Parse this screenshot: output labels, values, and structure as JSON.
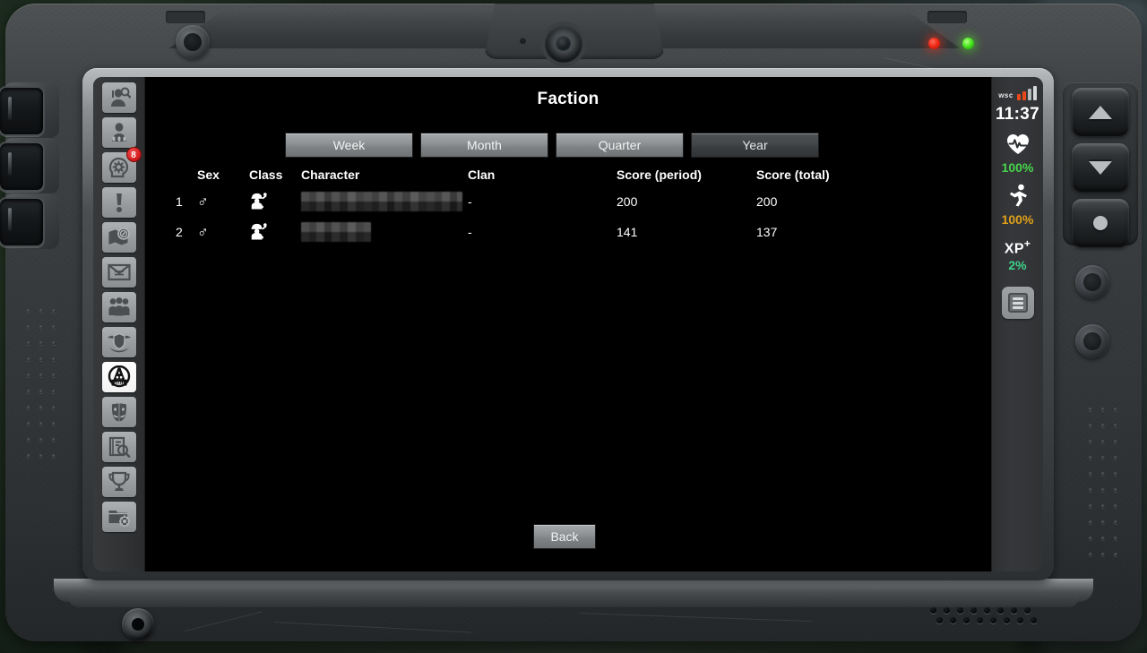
{
  "device": {
    "name": "rugged-tablet",
    "leds": [
      {
        "name": "led-red",
        "color": "#f02a16"
      },
      {
        "name": "led-green",
        "color": "#49e81f"
      }
    ],
    "hardware_buttons": [
      {
        "name": "up-button",
        "icon": "triangle-up-icon"
      },
      {
        "name": "down-button",
        "icon": "triangle-down-icon"
      },
      {
        "name": "select-button",
        "icon": "dot-icon"
      }
    ]
  },
  "sidebar": {
    "items": [
      {
        "name": "sidebar-item-character-search",
        "icon": "person-search-icon",
        "active": false,
        "badge": null
      },
      {
        "name": "sidebar-item-equipment",
        "icon": "person-equipment-icon",
        "active": false,
        "badge": null
      },
      {
        "name": "sidebar-item-skills",
        "icon": "head-gear-icon",
        "active": false,
        "badge": "8"
      },
      {
        "name": "sidebar-item-alerts",
        "icon": "exclamation-icon",
        "active": false,
        "badge": null
      },
      {
        "name": "sidebar-item-map",
        "icon": "map-compass-icon",
        "active": false,
        "badge": null
      },
      {
        "name": "sidebar-item-mail",
        "icon": "envelope-icon",
        "active": false,
        "badge": null
      },
      {
        "name": "sidebar-item-group",
        "icon": "group-people-icon",
        "active": false,
        "badge": null
      },
      {
        "name": "sidebar-item-clan",
        "icon": "winged-shield-icon",
        "active": false,
        "badge": null
      },
      {
        "name": "sidebar-item-faction",
        "icon": "anarchy-skull-icon",
        "active": true,
        "badge": null
      },
      {
        "name": "sidebar-item-reputation",
        "icon": "theatre-masks-icon",
        "active": false,
        "badge": null
      },
      {
        "name": "sidebar-item-journal",
        "icon": "book-search-icon",
        "active": false,
        "badge": null
      },
      {
        "name": "sidebar-item-achievements",
        "icon": "trophy-icon",
        "active": false,
        "badge": null
      },
      {
        "name": "sidebar-item-settings",
        "icon": "folder-gear-icon",
        "active": false,
        "badge": null
      }
    ]
  },
  "main": {
    "title": "Faction",
    "tabs": [
      {
        "label": "Week",
        "active": false
      },
      {
        "label": "Month",
        "active": false
      },
      {
        "label": "Quarter",
        "active": false
      },
      {
        "label": "Year",
        "active": true
      }
    ],
    "table": {
      "headers": {
        "rank": "",
        "sex": "Sex",
        "class": "Class",
        "character": "Character",
        "clan": "Clan",
        "score_period": "Score (period)",
        "score_total": "Score (total)"
      },
      "rows": [
        {
          "rank": "1",
          "sex_symbol": "♂",
          "class_icon": "engineer-icon",
          "character": "",
          "character_censored": true,
          "character_width": 180,
          "clan": "-",
          "score_period": "200",
          "score_total": "200"
        },
        {
          "rank": "2",
          "sex_symbol": "♂",
          "class_icon": "engineer-icon",
          "character": "",
          "character_censored": true,
          "character_width": 78,
          "clan": "-",
          "score_period": "141",
          "score_total": "137"
        }
      ]
    },
    "back_label": "Back"
  },
  "status": {
    "signal_label": "wsc",
    "signal_bars": [
      {
        "height": 7,
        "color": "#e8481c"
      },
      {
        "height": 10,
        "color": "#e8481c"
      },
      {
        "height": 13,
        "color": "#b7bbbd"
      },
      {
        "height": 16,
        "color": "#d5d9db"
      }
    ],
    "time": "11:37",
    "health": {
      "icon": "heart-pulse-icon",
      "value": "100%",
      "color": "#46d44a"
    },
    "stamina": {
      "icon": "running-person-icon",
      "value": "100%",
      "color": "#e0a018"
    },
    "xp": {
      "label": "XP",
      "superscript": "+",
      "value": "2%",
      "color": "#3fd08a"
    },
    "menu_icon": "hamburger-menu-icon"
  }
}
